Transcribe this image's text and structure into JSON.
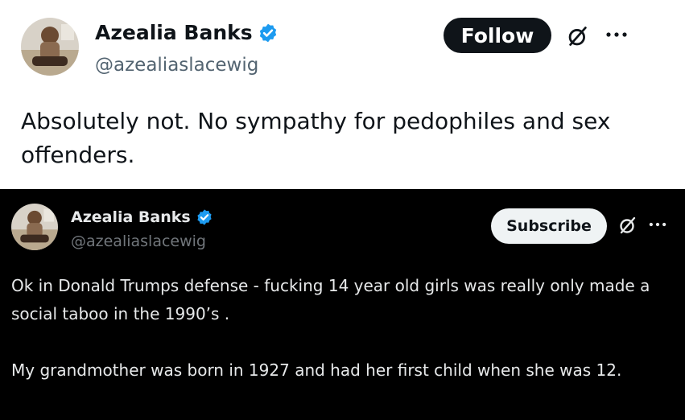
{
  "post_top": {
    "display_name": "Azealia Banks",
    "handle": "@azealiaslacewig",
    "follow_label": "Follow",
    "text": "Absolutely not. No sympathy for pedophiles and sex offenders.",
    "icons": [
      "verified-badge-icon",
      "grok-icon",
      "more-icon"
    ]
  },
  "post_bottom": {
    "display_name": "Azealia Banks",
    "handle": "@azealiaslacewig",
    "subscribe_label": "Subscribe",
    "paragraphs": [
      "Ok in Donald Trumps defense - fucking 14 year old girls was really only made a social taboo in the 1990’s .",
      "My grandmother was born in 1927 and had her first child when she was 12."
    ],
    "icons": [
      "verified-badge-icon",
      "grok-icon",
      "more-icon"
    ]
  },
  "colors": {
    "verified_blue": "#1d9bf0",
    "light_bg": "#ffffff",
    "dark_bg": "#000000",
    "follow_button_bg": "#0f1419",
    "subscribe_button_bg": "#eff3f4"
  }
}
